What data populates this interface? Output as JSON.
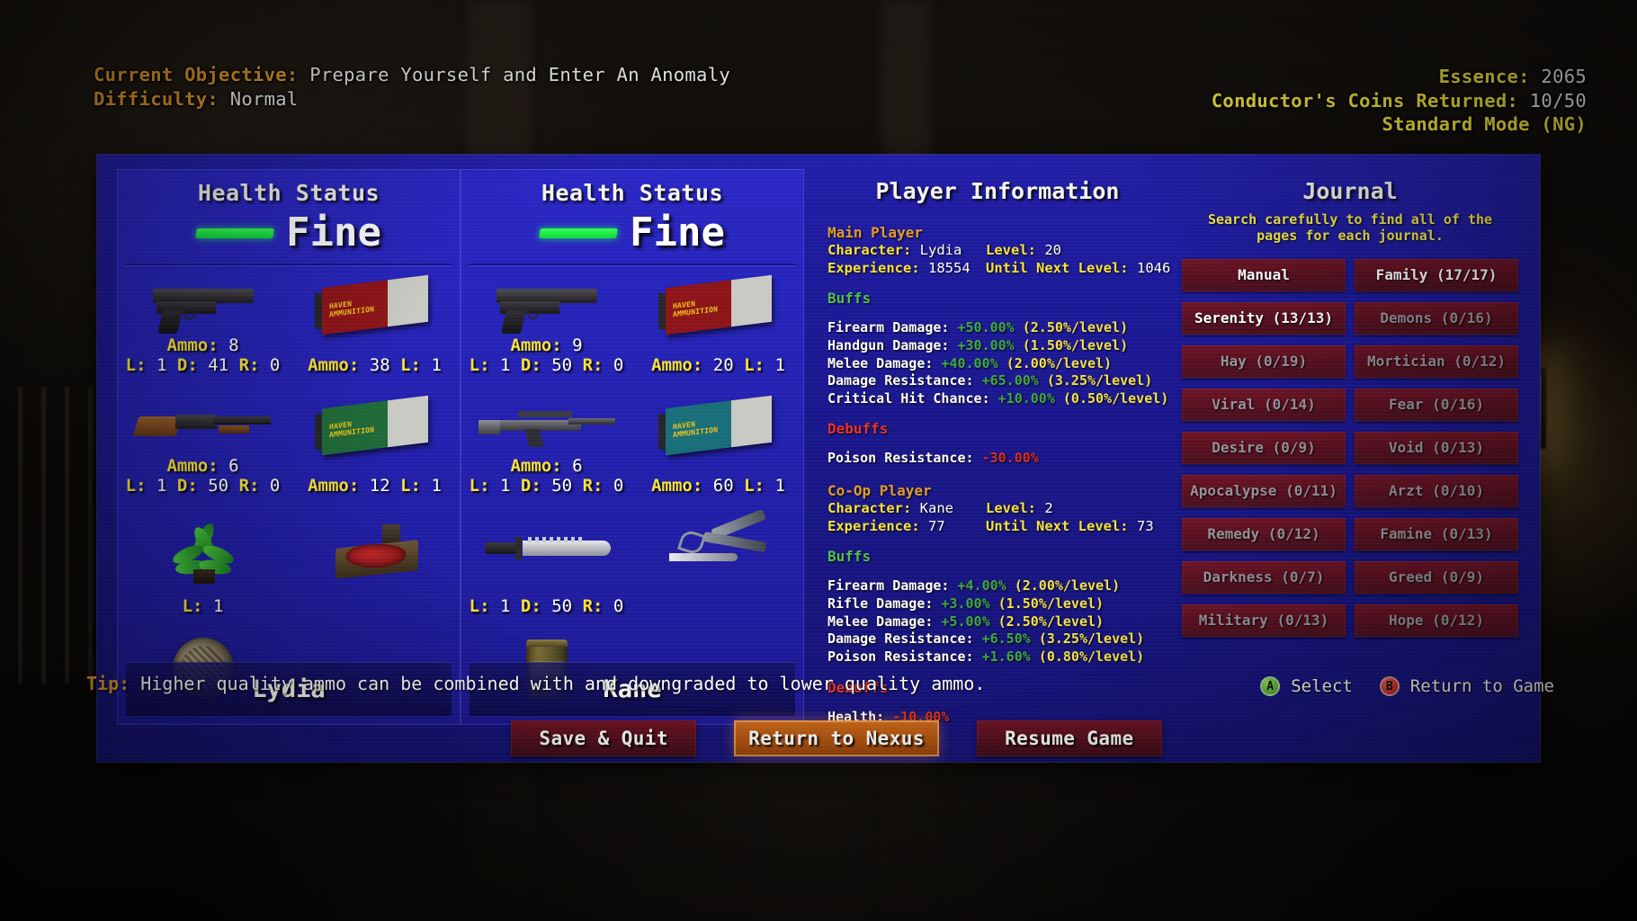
{
  "header": {
    "objective_label": "Current Objective:",
    "objective_value": "Prepare Yourself and Enter An Anomaly",
    "difficulty_label": "Difficulty:",
    "difficulty_value": "Normal",
    "essence_label": "Essence:",
    "essence_value": "2065",
    "coins_label": "Conductor's Coins Returned:",
    "coins_value": "10/50",
    "mode": "Standard Mode (NG)"
  },
  "inventories": [
    {
      "title": "Health Status",
      "health_state": "Fine",
      "character_name": "Lydia",
      "slots": [
        {
          "icon": "pistol-icon",
          "ammo_label": "Ammo:",
          "ammo_value": "8",
          "l_label": "L:",
          "l_value": "1",
          "d_label": "D:",
          "d_value": "41",
          "r_label": "R:",
          "r_value": "0"
        },
        {
          "icon": "ammo-box-red-icon",
          "ammo_label": "Ammo:",
          "ammo_value": "38",
          "l_label": "L:",
          "l_value": "1"
        },
        {
          "icon": "shotgun-icon",
          "ammo_label": "Ammo:",
          "ammo_value": "6",
          "l_label": "L:",
          "l_value": "1",
          "d_label": "D:",
          "d_value": "50",
          "r_label": "R:",
          "r_value": "0"
        },
        {
          "icon": "ammo-box-green-icon",
          "ammo_label": "Ammo:",
          "ammo_value": "12",
          "l_label": "L:",
          "l_value": "1"
        },
        {
          "icon": "plant-icon",
          "l_label": "L:",
          "l_value": "1"
        },
        {
          "icon": "meat-icon"
        },
        {
          "icon": "coin-icon"
        }
      ]
    },
    {
      "title": "Health Status",
      "health_state": "Fine",
      "character_name": "Kane",
      "slots": [
        {
          "icon": "pistol-icon",
          "ammo_label": "Ammo:",
          "ammo_value": "9",
          "l_label": "L:",
          "l_value": "1",
          "d_label": "D:",
          "d_value": "50",
          "r_label": "R:",
          "r_value": "0"
        },
        {
          "icon": "ammo-box-red-icon",
          "ammo_label": "Ammo:",
          "ammo_value": "20",
          "l_label": "L:",
          "l_value": "1"
        },
        {
          "icon": "rifle-icon",
          "ammo_label": "Ammo:",
          "ammo_value": "6",
          "l_label": "L:",
          "l_value": "1",
          "d_label": "D:",
          "d_value": "50",
          "r_label": "R:",
          "r_value": "0"
        },
        {
          "icon": "ammo-box-teal-icon",
          "ammo_label": "Ammo:",
          "ammo_value": "60",
          "l_label": "L:",
          "l_value": "1"
        },
        {
          "icon": "knife-icon",
          "l_label": "L:",
          "l_value": "1",
          "d_label": "D:",
          "d_value": "50",
          "r_label": "R:",
          "r_value": "0"
        },
        {
          "icon": "tools-icon"
        },
        {
          "icon": "can-icon"
        }
      ]
    }
  ],
  "player_info": {
    "title": "Player Information",
    "main": {
      "group": "Main Player",
      "character_label": "Character:",
      "character_value": "Lydia",
      "level_label": "Level:",
      "level_value": "20",
      "experience_label": "Experience:",
      "experience_value": "18554",
      "until_label": "Until Next Level:",
      "until_value": "1046",
      "buffs_title": "Buffs",
      "buffs": [
        {
          "name": "Firearm Damage:",
          "amount": "+50.00%",
          "per": "(2.50%/level)"
        },
        {
          "name": "Handgun Damage:",
          "amount": "+30.00%",
          "per": "(1.50%/level)"
        },
        {
          "name": "Melee Damage:",
          "amount": "+40.00%",
          "per": "(2.00%/level)"
        },
        {
          "name": "Damage Resistance:",
          "amount": "+65.00%",
          "per": "(3.25%/level)"
        },
        {
          "name": "Critical Hit Chance:",
          "amount": "+10.00%",
          "per": "(0.50%/level)"
        }
      ],
      "debuffs_title": "Debuffs",
      "debuffs": [
        {
          "name": "Poison Resistance:",
          "amount": "-30.00%",
          "per": ""
        }
      ]
    },
    "coop": {
      "group": "Co-Op Player",
      "character_label": "Character:",
      "character_value": "Kane",
      "level_label": "Level:",
      "level_value": "2",
      "experience_label": "Experience:",
      "experience_value": "77",
      "until_label": "Until Next Level:",
      "until_value": "73",
      "buffs_title": "Buffs",
      "buffs": [
        {
          "name": "Firearm Damage:",
          "amount": "+4.00%",
          "per": "(2.00%/level)"
        },
        {
          "name": "Rifle Damage:",
          "amount": "+3.00%",
          "per": "(1.50%/level)"
        },
        {
          "name": "Melee Damage:",
          "amount": "+5.00%",
          "per": "(2.50%/level)"
        },
        {
          "name": "Damage Resistance:",
          "amount": "+6.50%",
          "per": "(3.25%/level)"
        },
        {
          "name": "Poison Resistance:",
          "amount": "+1.60%",
          "per": "(0.80%/level)"
        }
      ],
      "debuffs_title": "Debuffs",
      "debuffs": [
        {
          "name": "Health:",
          "amount": "-10.00%",
          "per": ""
        }
      ]
    }
  },
  "journal": {
    "title": "Journal",
    "subtitle": "Search carefully to find all of the pages for each journal.",
    "entries": [
      {
        "label": "Manual",
        "found": true
      },
      {
        "label": "Family (17/17)",
        "found": true
      },
      {
        "label": "Serenity (13/13)",
        "found": true
      },
      {
        "label": "Demons (0/16)",
        "found": false
      },
      {
        "label": "Hay (0/19)",
        "found": false
      },
      {
        "label": "Mortician (0/12)",
        "found": false
      },
      {
        "label": "Viral (0/14)",
        "found": false
      },
      {
        "label": "Fear (0/16)",
        "found": false
      },
      {
        "label": "Desire (0/9)",
        "found": false
      },
      {
        "label": "Void (0/13)",
        "found": false
      },
      {
        "label": "Apocalypse (0/11)",
        "found": false
      },
      {
        "label": "Arzt (0/10)",
        "found": false
      },
      {
        "label": "Remedy (0/12)",
        "found": false
      },
      {
        "label": "Famine (0/13)",
        "found": false
      },
      {
        "label": "Darkness (0/7)",
        "found": false
      },
      {
        "label": "Greed (0/9)",
        "found": false
      },
      {
        "label": "Military (0/13)",
        "found": false
      },
      {
        "label": "Hope (0/12)",
        "found": false
      }
    ]
  },
  "buttons": [
    {
      "label": "Save & Quit",
      "selected": false
    },
    {
      "label": "Return to Nexus",
      "selected": true
    },
    {
      "label": "Resume Game",
      "selected": false
    }
  ],
  "footer": {
    "tip_label": "Tip:",
    "tip_text": "Higher quality ammo can be combined with and downgraded to lower quality ammo.",
    "hints": [
      {
        "button": "A",
        "label": "Select",
        "color": "#5aa832"
      },
      {
        "button": "B",
        "label": "Return to Game",
        "color": "#c43028"
      }
    ]
  }
}
